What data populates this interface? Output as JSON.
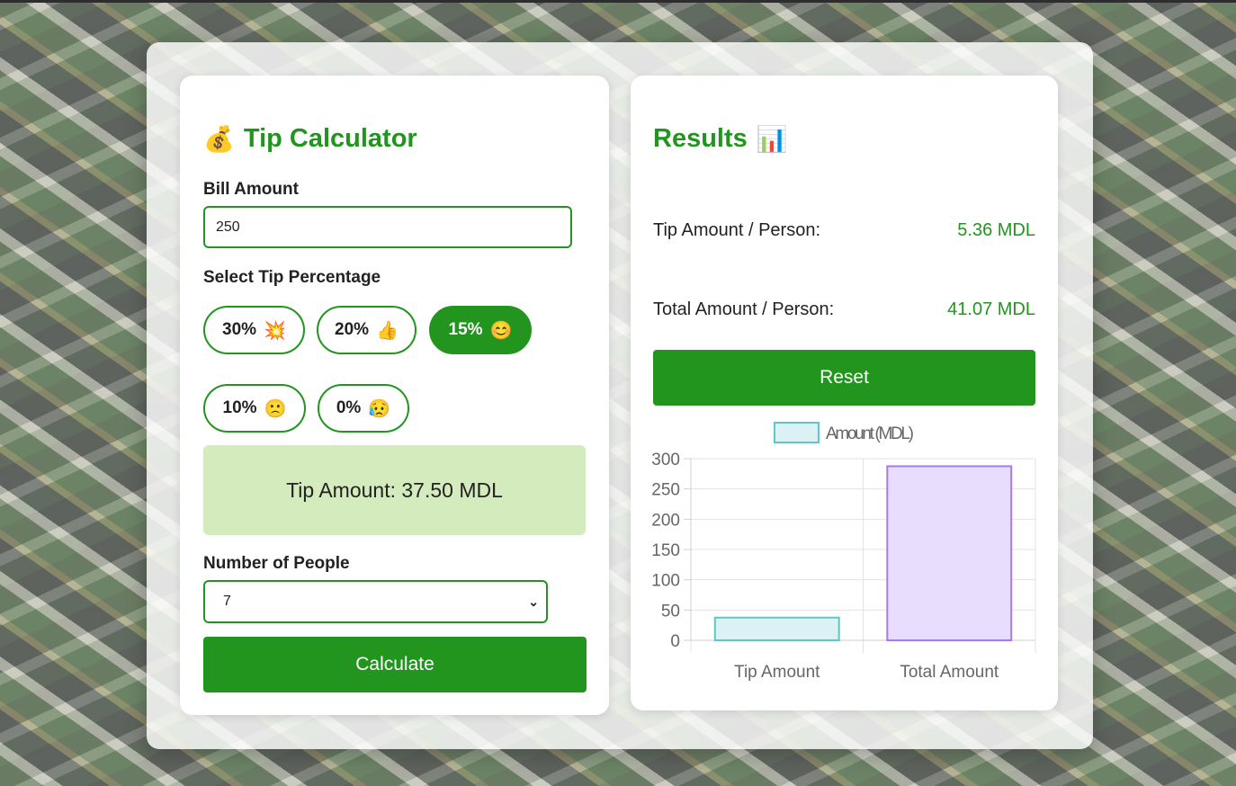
{
  "app": {
    "title": "Tip Calculator",
    "title_icon": "money-bag-icon",
    "accent_color": "#22951f"
  },
  "form": {
    "bill_label": "Bill Amount",
    "bill_value": "250",
    "tip_label": "Select Tip Percentage",
    "tip_options": [
      {
        "label": "30%",
        "emoji": "💥",
        "active": false
      },
      {
        "label": "20%",
        "emoji": "👍",
        "active": false
      },
      {
        "label": "15%",
        "emoji": "😊",
        "active": true
      },
      {
        "label": "10%",
        "emoji": "🙁",
        "active": false
      },
      {
        "label": "0%",
        "emoji": "😥",
        "active": false
      }
    ],
    "tip_amount_text": "Tip Amount: 37.50 MDL",
    "people_label": "Number of People",
    "people_value": "7",
    "calculate_label": "Calculate"
  },
  "results": {
    "title": "Results",
    "title_icon": "bar-chart-icon",
    "tip_per_person_label": "Tip Amount / Person:",
    "tip_per_person_value": "5.36 MDL",
    "total_per_person_label": "Total Amount / Person:",
    "total_per_person_value": "41.07 MDL",
    "reset_label": "Reset"
  },
  "chart_data": {
    "type": "bar",
    "categories": [
      "Tip Amount",
      "Total Amount"
    ],
    "series": [
      {
        "name": "Amount (MDL)",
        "values": [
          37.5,
          287.5
        ]
      }
    ],
    "bar_fills": [
      "#dbf1f3",
      "#e9ddfd"
    ],
    "bar_strokes": [
      "#5fc7c7",
      "#a57af2"
    ],
    "ylim": [
      0,
      300
    ],
    "yticks": [
      0,
      50,
      100,
      150,
      200,
      250,
      300
    ],
    "grid": true,
    "legend": "top"
  }
}
